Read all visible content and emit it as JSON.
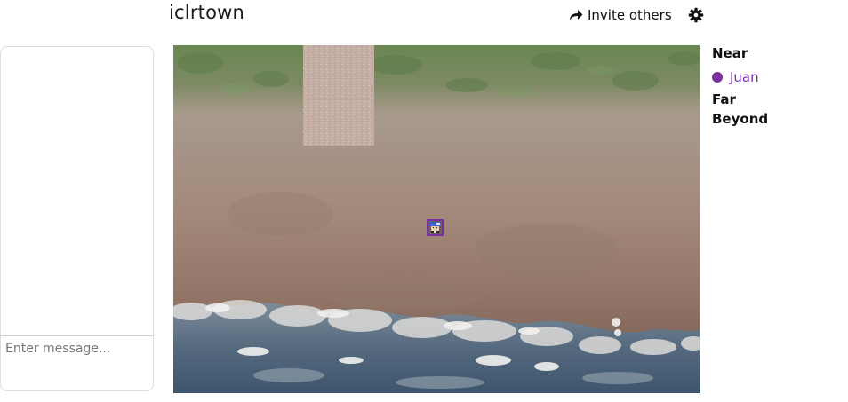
{
  "header": {
    "title": "iclrtown",
    "invite_label": "Invite others",
    "invite_icon": "share-arrow-icon",
    "settings_icon": "gear-icon"
  },
  "chat": {
    "placeholder": "Enter message..."
  },
  "map": {
    "avatar_icon": "player-avatar-icon"
  },
  "proximity": {
    "near_label": "Near",
    "far_label": "Far",
    "beyond_label": "Beyond",
    "near_users": [
      {
        "name": "Juan",
        "color": "#7b2fa0"
      }
    ]
  },
  "colors": {
    "user_accent": "#7b2fa0",
    "grass": "#6b8a55",
    "sand": "#a08474",
    "water": "#4a6278",
    "foam": "#e6e4e2",
    "path": "#c7b1a6"
  }
}
